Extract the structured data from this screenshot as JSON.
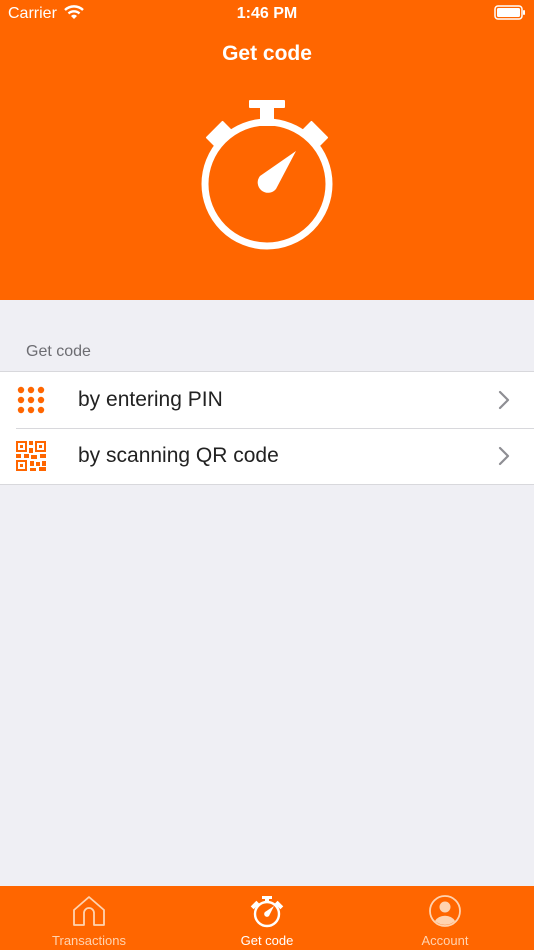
{
  "status_bar": {
    "carrier": "Carrier",
    "time": "1:46 PM"
  },
  "nav": {
    "title": "Get code"
  },
  "section": {
    "header": "Get code",
    "items": [
      {
        "label": "by entering PIN",
        "icon": "keypad-icon"
      },
      {
        "label": "by scanning QR code",
        "icon": "qr-code-icon"
      }
    ]
  },
  "tab_bar": {
    "tabs": [
      {
        "label": "Transactions",
        "icon": "home-icon",
        "selected": false
      },
      {
        "label": "Get code",
        "icon": "stopwatch-icon",
        "selected": true
      },
      {
        "label": "Account",
        "icon": "user-icon",
        "selected": false
      }
    ]
  },
  "colors": {
    "brand": "#FF6600",
    "background": "#EFEFF4",
    "selected_tab_label": "#FFFFFF",
    "unselected_tab_label": "#FFD3B0"
  }
}
